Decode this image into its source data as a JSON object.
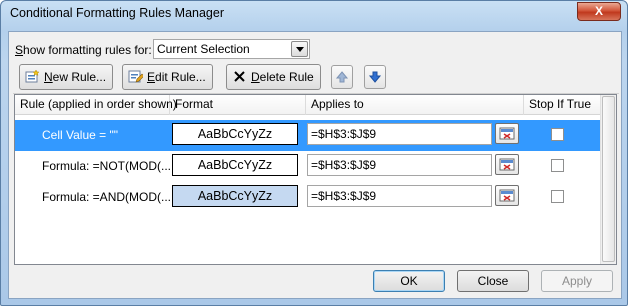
{
  "window": {
    "title": "Conditional Formatting Rules Manager",
    "close_label": "X"
  },
  "show_rules": {
    "label": "Show formatting rules for:",
    "selected": "Current Selection"
  },
  "toolbar": {
    "new_rule": "New Rule...",
    "edit_rule": "Edit Rule...",
    "delete_rule": "Delete Rule"
  },
  "columns": {
    "rule": "Rule (applied in order shown)",
    "format": "Format",
    "applies_to": "Applies to",
    "stop_if_true": "Stop If True"
  },
  "rules": [
    {
      "rule": "Cell Value = \"\"",
      "format_sample": "AaBbCcYyZz",
      "applies_to": "=$H$3:$J$9",
      "stop_if_true": false,
      "selected": true,
      "format_fill": "#ffffff"
    },
    {
      "rule": "Formula: =NOT(MOD(...",
      "format_sample": "AaBbCcYyZz",
      "applies_to": "=$H$3:$J$9",
      "stop_if_true": false,
      "selected": false,
      "format_fill": "#ffffff"
    },
    {
      "rule": "Formula: =AND(MOD(...",
      "format_sample": "AaBbCcYyZz",
      "applies_to": "=$H$3:$J$9",
      "stop_if_true": false,
      "selected": false,
      "format_fill": "#c5d9f1"
    }
  ],
  "buttons": {
    "ok": "OK",
    "close": "Close",
    "apply": "Apply"
  },
  "colors": {
    "selection": "#3399ff",
    "close_button": "#c7432b"
  }
}
